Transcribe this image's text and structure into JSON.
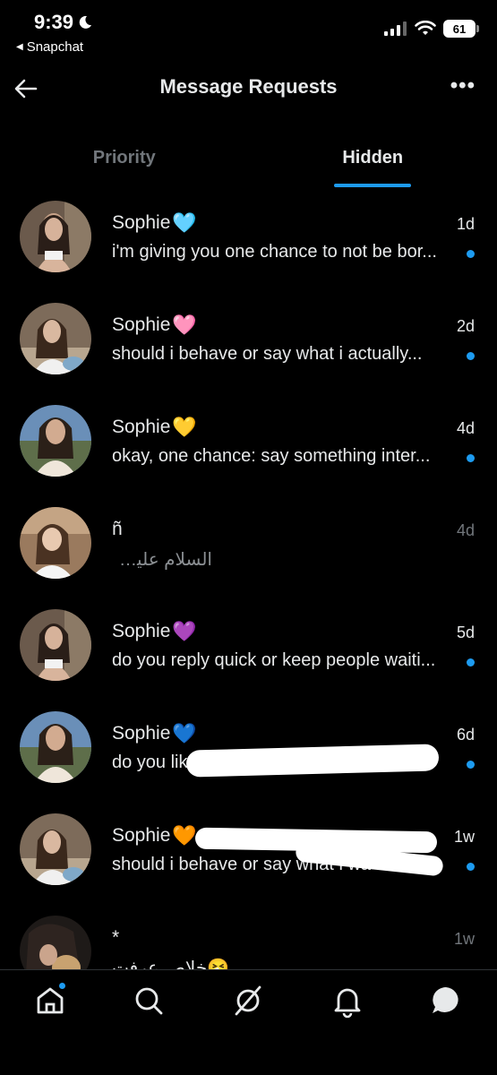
{
  "status_bar": {
    "time": "9:39",
    "back_app": "Snapchat",
    "battery": "61"
  },
  "header": {
    "title": "Message Requests",
    "more_label": "•••"
  },
  "tabs": [
    {
      "label": "Priority",
      "active": false
    },
    {
      "label": "Hidden",
      "active": true
    }
  ],
  "conversations": [
    {
      "name": "Sophie",
      "heart": "🩵",
      "time": "1d",
      "preview": "i'm giving you one chance to not be bor...",
      "unread": true
    },
    {
      "name": "Sophie",
      "heart": "🩷",
      "time": "2d",
      "preview": "should i behave or say what i actually...",
      "unread": true
    },
    {
      "name": "Sophie",
      "heart": "💛",
      "time": "4d",
      "preview": "okay, one chance: say something inter...",
      "unread": true
    },
    {
      "name": "ñ",
      "heart": "",
      "time": "4d",
      "preview": "السلام عليكم.",
      "unread": false
    },
    {
      "name": "Sophie",
      "heart": "💜",
      "time": "5d",
      "preview": "do you reply quick or keep people waiti...",
      "unread": true
    },
    {
      "name": "Sophie",
      "heart": "💙",
      "time": "6d",
      "preview": "do you lik",
      "unread": true
    },
    {
      "name": "Sophie",
      "heart": "🧡",
      "time": "1w",
      "preview": "should i behave or say what i wa",
      "unread": true
    },
    {
      "name": "*",
      "heart": "",
      "time": "1w",
      "preview": "🤧خلاص عرفت",
      "unread": false
    }
  ],
  "colors": {
    "accent": "#1d9bf0",
    "background": "#000000",
    "text_primary": "#e7e9ea",
    "text_secondary": "#71767b"
  },
  "bottom_nav": [
    {
      "icon": "home-icon",
      "has_badge": true
    },
    {
      "icon": "search-icon",
      "has_badge": false
    },
    {
      "icon": "grok-icon",
      "has_badge": false
    },
    {
      "icon": "bell-icon",
      "has_badge": false
    },
    {
      "icon": "messages-icon",
      "has_badge": false
    }
  ]
}
